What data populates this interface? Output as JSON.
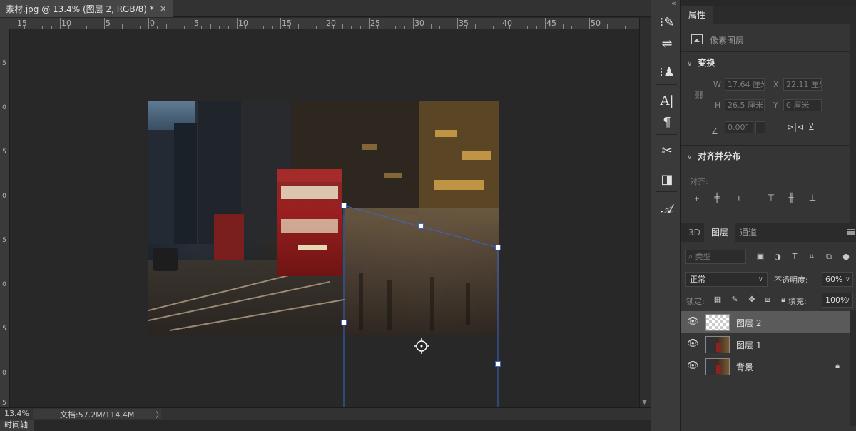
{
  "document": {
    "tab_title": "素材.jpg @ 13.4% (图层 2, RGB/8) *",
    "close_glyph": "×"
  },
  "rulers": {
    "horizontal_labels": [
      "15",
      "10",
      "5",
      "0",
      "5",
      "10",
      "15",
      "20",
      "25",
      "30",
      "35",
      "40",
      "45",
      "50"
    ],
    "vertical_labels": [
      "5",
      "0",
      "5",
      "0",
      "5",
      "0",
      "5",
      "0",
      "5"
    ]
  },
  "status_bar": {
    "zoom": "13.4%",
    "doc_size": "文档:57.2M/114.4M",
    "arrow": "〉"
  },
  "timeline": {
    "tab_label": "时间轴"
  },
  "tool_column": {
    "collapse_glyph": "«",
    "tools": [
      {
        "name": "brush-settings-icon",
        "glyph": "⁝✎"
      },
      {
        "name": "adjustments-icon",
        "glyph": "⇌"
      },
      {
        "name": "clone-source-icon",
        "glyph": "⁝♟"
      },
      {
        "name": "character-icon",
        "glyph": "A|"
      },
      {
        "name": "paragraph-icon",
        "glyph": "¶"
      },
      {
        "name": "tool-presets-icon",
        "glyph": "✂"
      },
      {
        "name": "history-icon",
        "glyph": "◨"
      },
      {
        "name": "glyphs-icon",
        "glyph": "𝒜"
      }
    ]
  },
  "properties_panel": {
    "tab_label": "属性",
    "layer_type": "像素图层",
    "transform_section": "变换",
    "fields": {
      "w_label": "W",
      "w_value": "17.64 厘米",
      "x_label": "X",
      "x_value": "22.11 厘米",
      "h_label": "H",
      "h_value": "26.5 厘米",
      "y_label": "Y",
      "y_value": "0 厘米",
      "angle_value": "0.00°"
    },
    "align_section": "对齐并分布",
    "align_label": "对齐:"
  },
  "layers_panel": {
    "tabs": [
      {
        "label": "3D",
        "active": false
      },
      {
        "label": "图层",
        "active": true
      },
      {
        "label": "通道",
        "active": false
      }
    ],
    "search_placeholder": "类型",
    "blend_mode": "正常",
    "opacity_label": "不透明度:",
    "opacity_value": "60%",
    "lock_label": "锁定:",
    "fill_label": "填充:",
    "fill_value": "100%",
    "layers": [
      {
        "name": "图层 2",
        "selected": true,
        "thumbnail": "transparent",
        "locked": false
      },
      {
        "name": "图层 1",
        "selected": false,
        "thumbnail": "photo",
        "locked": false
      },
      {
        "name": "背景",
        "selected": false,
        "thumbnail": "photo",
        "locked": true
      }
    ]
  },
  "colors": {
    "canvas_bg": "#282828",
    "panel_bg": "#353535",
    "transform_line": "#3e64c8",
    "selected_layer": "#5a5a5a"
  }
}
